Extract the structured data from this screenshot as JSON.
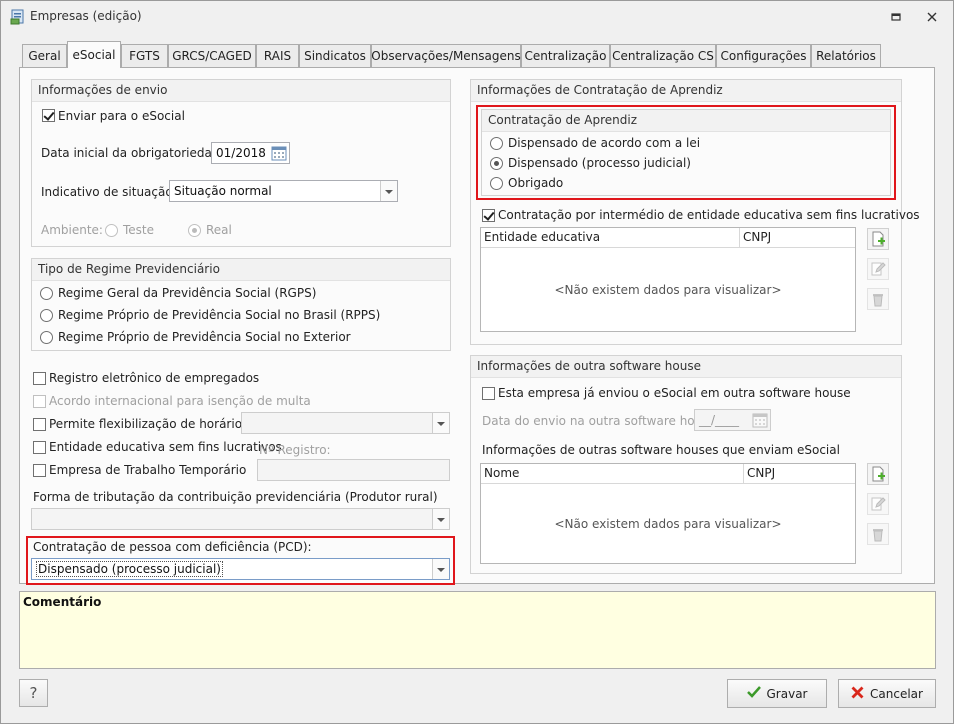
{
  "window": {
    "title": "Empresas (edição)"
  },
  "tabs": [
    "Geral",
    "eSocial",
    "FGTS",
    "GRCS/CAGED",
    "RAIS",
    "Sindicatos",
    "Observações/Mensagens",
    "Centralização",
    "Centralização CS",
    "Configurações",
    "Relatórios"
  ],
  "envio": {
    "title": "Informações de envio",
    "enviar_label": "Enviar para o eSocial",
    "data_label": "Data inicial da obrigatoriedade:",
    "data_value": "01/2018",
    "situacao_label": "Indicativo de situação:",
    "situacao_value": "Situação normal",
    "ambiente_label": "Ambiente:",
    "ambiente_teste": "Teste",
    "ambiente_real": "Real"
  },
  "regime": {
    "title": "Tipo de Regime Previdenciário",
    "options": [
      "Regime Geral da Previdência Social (RGPS)",
      "Regime Próprio de Previdência Social no Brasil (RPPS)",
      "Regime Próprio de Previdência Social no Exterior"
    ]
  },
  "checks": {
    "registro": "Registro eletrônico de empregados",
    "acordo": "Acordo internacional para isenção de multa",
    "flexibilizacao": "Permite flexibilização de horários",
    "entidade": "Entidade educativa sem fins lucrativos",
    "registro_num_label": "Nº Registro:",
    "temporario": "Empresa de Trabalho Temporário"
  },
  "tributacao": {
    "label": "Forma de tributação da contribuição previdenciária (Produtor rural)",
    "value": ""
  },
  "pcd": {
    "label": "Contratação de pessoa com deficiência (PCD):",
    "value": "Dispensado (processo judicial)"
  },
  "aprendiz": {
    "title": "Informações de Contratação de Aprendiz",
    "inner_title": "Contratação de Aprendiz",
    "options": [
      "Dispensado de acordo com a lei",
      "Dispensado (processo judicial)",
      "Obrigado"
    ],
    "selected_index": 1,
    "intermedio_label": "Contratação por intermédio de entidade educativa sem fins lucrativos",
    "grid_columns": [
      "Entidade educativa",
      "CNPJ"
    ],
    "empty_text": "<Não existem dados para visualizar>"
  },
  "software": {
    "title": "Informações de outra software house",
    "check_label": "Esta empresa já enviou o eSocial em outra software house",
    "data_label": "Data do envio na outra software house:",
    "data_placeholder": "__/____",
    "list_label": "Informações de outras software houses que enviam eSocial",
    "grid_columns": [
      "Nome",
      "CNPJ"
    ],
    "empty_text": "<Não existem dados para visualizar>"
  },
  "comentario": {
    "label": "Comentário"
  },
  "footer": {
    "help": "?",
    "gravar": "Gravar",
    "cancelar": "Cancelar"
  },
  "colors": {
    "highlight": "#e0161b",
    "comment_bg": "#ffffe1",
    "check_green": "#3c9a2a",
    "cancel_red": "#d9271b"
  }
}
